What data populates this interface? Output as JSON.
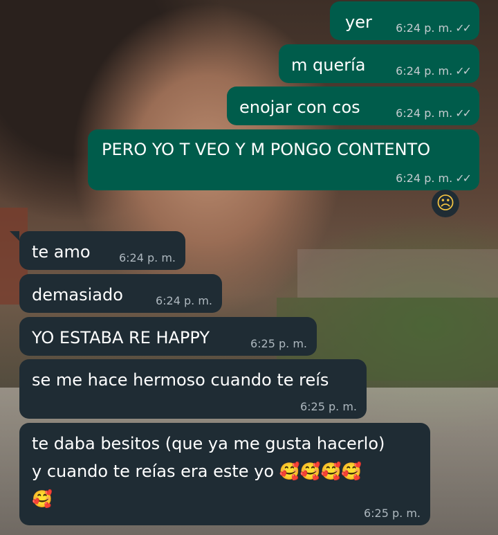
{
  "chat": {
    "outgoing": [
      {
        "text": "yer",
        "time": "6:24 p. m.",
        "status_icon": "double-check-icon"
      },
      {
        "text": "m quería",
        "time": "6:24 p. m.",
        "status_icon": "double-check-icon"
      },
      {
        "text": "enojar con cos",
        "time": "6:24 p. m.",
        "status_icon": "double-check-icon"
      },
      {
        "text": "PERO YO T VEO Y M PONGO CONTENTO",
        "time": "6:24 p. m.",
        "status_icon": "double-check-icon",
        "reaction": "☹"
      }
    ],
    "incoming": [
      {
        "text": "te amo",
        "time": "6:24 p. m."
      },
      {
        "text": "demasiado",
        "time": "6:24 p. m."
      },
      {
        "text": "YO ESTABA RE HAPPY",
        "time": "6:25 p. m."
      },
      {
        "text": "se me hace hermoso cuando te reís",
        "time": "6:25 p. m."
      },
      {
        "text_line1": "te daba besitos (que ya me gusta hacerlo)",
        "text_line2": "y cuando te reías era este yo 🥰🥰🥰🥰",
        "text_line3": "🥰",
        "time": "6:25 p. m."
      }
    ]
  },
  "colors": {
    "outgoing_bubble": "#005c4b",
    "incoming_bubble": "#1f2c34",
    "timestamp": "#c5ccd0"
  }
}
